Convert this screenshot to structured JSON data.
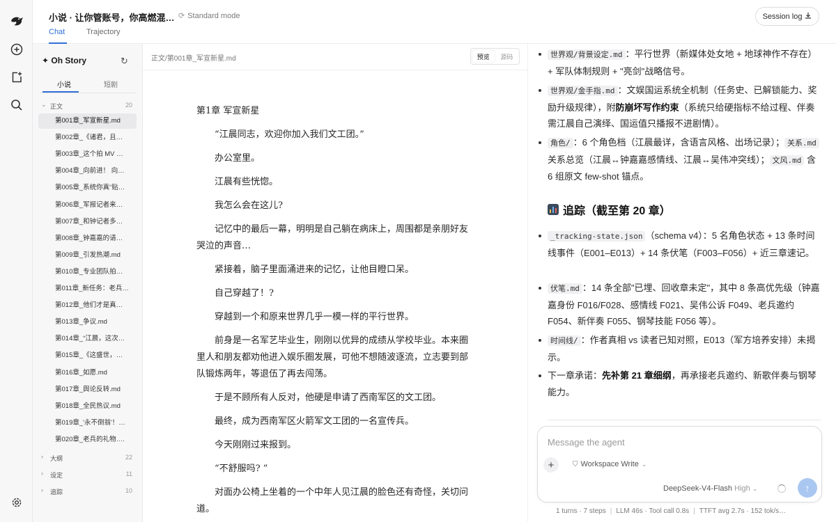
{
  "header": {
    "title": "小说 · 让你管账号，你高燃混…",
    "mode": "Standard mode",
    "tabs": [
      "Chat",
      "Trajectory"
    ],
    "session_log": "Session log"
  },
  "sidebar": {
    "story_title": "✦ Oh Story",
    "subtabs": [
      "小说",
      "短剧"
    ],
    "folders": [
      {
        "name": "正文",
        "count": "20",
        "chevron": "⌄"
      },
      {
        "name": "大纲",
        "count": "22",
        "chevron": "›"
      },
      {
        "name": "设定",
        "count": "11",
        "chevron": "›"
      },
      {
        "name": "追踪",
        "count": "10",
        "chevron": "›"
      }
    ],
    "files": [
      "第001章_军宣新星.md",
      "第002章_《诸君，且…",
      "第003章_这个拍 MV …",
      "第004章_向前进！ 向…",
      "第005章_系统你真“贴…",
      "第006章_军报记者来…",
      "第007章_和钟记者多…",
      "第008章_钟嘉嘉的请…",
      "第009章_引发热潮.md",
      "第010章_专业团队拍…",
      "第011章_新任务：老兵…",
      "第012章_他们才是真…",
      "第013章_争议.md",
      "第014章_“江晨，这次…",
      "第015章_《这盛世，…",
      "第016章_如愿.md",
      "第017章_舆论反转.md",
      "第018章_全民热议.md",
      "第019章_'永不倒翁'！…",
      "第020章_老兵的礼物…."
    ]
  },
  "editor": {
    "path": "正文/第001章_军宣新星.md",
    "toggle": [
      "预览",
      "源码"
    ],
    "heading": "第1章 军宣新星",
    "paragraphs": [
      "“江晨同志，欢迎你加入我们文工团。”",
      "办公室里。",
      "江晨有些恍惚。",
      "我怎么会在这儿?",
      "记忆中的最后一幕，明明是自己躺在病床上，周围都是亲朋好友哭泣的声音…",
      "紧接着，脑子里面涌进来的记忆，让他目瞪口呆。",
      "自己穿越了！?",
      "穿越到一个和原来世界几乎一模一样的平行世界。",
      "前身是一名军艺毕业生，刚刚以优异的成绩从学校毕业。本来圈里人和朋友都劝他进入娱乐圈发展，可他不想随波逐流，立志要到部队锻炼两年，等退伍了再去闯荡。",
      "于是不顾所有人反对，他硬是申请了西南军区的文工团。",
      "最终，成为西南军区火箭军文工团的一名宣传兵。",
      "今天刚刚过来报到。",
      "“不舒服吗? ”",
      "对面办公椅上坐着的一个中年人见江晨的脸色还有奇怪，关切问道。"
    ]
  },
  "chat": {
    "bullets_top": [
      {
        "code": "世界观/背景设定.md",
        "text": "：平行世界（新媒体处女地 + 地球神作不存在）+ 军队体制规则 + \"亮剑\"战略信号。"
      },
      {
        "code": "世界观/金手指.md",
        "pre": "：文娱国运系统全机制（任务史、已解锁能力、奖励升级规律），附",
        "bold": "防崩坏写作约束",
        "post": "（系统只给硬指标不给过程、伴奏需江晨自己演绎、国运值只播报不进剧情）。"
      },
      {
        "code": "角色/",
        "text": "：6 个角色档（江晨最详，含语言风格、出场记录）；",
        "code2": "关系.md",
        "text2": " 关系总览（江晨↔钟嘉嘉感情线、江晨↔吴伟冲突线）；",
        "code3": "文风.md",
        "text3": " 含 6 组原文 few-shot 锚点。"
      }
    ],
    "section_heading": "追踪（截至第 20 章）",
    "bullets_bottom": [
      {
        "code": "_tracking-state.json",
        "text": "（schema v4）：5 名角色状态 + 13 条时间线事件（E001–E013）+ 14 条伏笔（F003–F056）+ 近三章速记。"
      },
      {
        "code": "伏笔.md",
        "text": "：14 条全部\"已埋、回收章未定\"，其中 8 条高优先级（钟嘉嘉身份 F016/F028、感情线 F021、吴伟公诉 F049、老兵邀约 F054、新伴奏 F055、钢琴技能 F056 等）。"
      },
      {
        "code": "时间线/",
        "text": "：作者真相 vs 读者已知对照，E013（军方培养安排）未揭示。"
      },
      {
        "pre": "下一章承诺：",
        "bold": "先补第 21 章细纲",
        "post": "，再承接老兵邀约、新歌伴奏与钢琴能力。"
      }
    ],
    "composer": {
      "placeholder": "Message the agent",
      "workspace": "Workspace Write",
      "model": "DeepSeek-V4-Flash",
      "level": "High"
    },
    "stats": [
      "1 turns · 7 steps",
      "LLM 46s · Tool call 0.8s",
      "TTFT avg 2.7s · 152 tok/s…"
    ]
  },
  "colors": {
    "accent": "#2f6fd6",
    "send": "#a9c7f0",
    "sidebar_bg": "#f7f7f8"
  }
}
